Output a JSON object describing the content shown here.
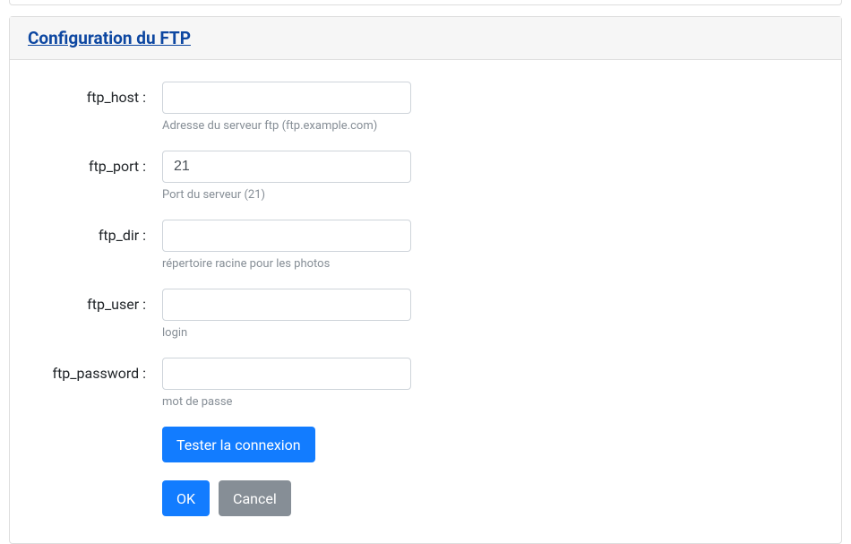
{
  "section": {
    "title": "Configuration du FTP"
  },
  "fields": {
    "host": {
      "label": "ftp_host :",
      "value": "",
      "help": "Adresse du serveur ftp (ftp.example.com)"
    },
    "port": {
      "label": "ftp_port :",
      "value": "21",
      "help": "Port du serveur (21)"
    },
    "dir": {
      "label": "ftp_dir :",
      "value": "",
      "help": "répertoire racine pour les photos"
    },
    "user": {
      "label": "ftp_user :",
      "value": "",
      "help": "login"
    },
    "password": {
      "label": "ftp_password :",
      "value": "",
      "help": "mot de passe"
    }
  },
  "buttons": {
    "test": "Tester la connexion",
    "ok": "OK",
    "cancel": "Cancel"
  }
}
